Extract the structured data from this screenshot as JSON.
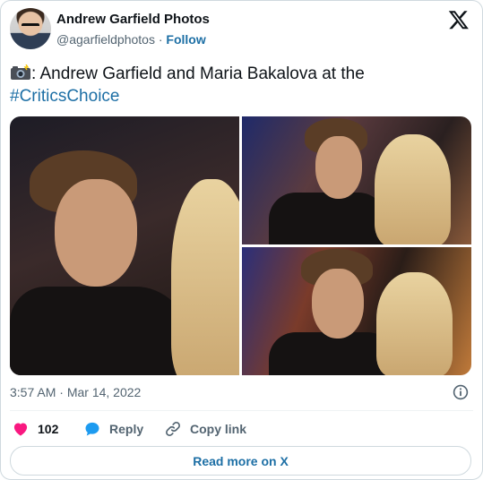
{
  "author": {
    "display_name": "Andrew Garfield Photos",
    "handle": "@agarfieldphotos",
    "separator": "·",
    "follow_label": "Follow"
  },
  "tweet": {
    "text_after_emoji": ": Andrew Garfield and Maria Bakalova at the",
    "hashtag": "#CriticsChoice",
    "emoji_icon": "camera-flash-icon"
  },
  "media": {
    "photo_count": 3
  },
  "meta": {
    "time": "3:57 AM",
    "separator": "·",
    "date": "Mar 14, 2022"
  },
  "actions": {
    "like_count": "102",
    "reply_label": "Reply",
    "copy_link_label": "Copy link"
  },
  "footer": {
    "read_more_label": "Read more on X"
  },
  "colors": {
    "link": "#1d6fa5",
    "like": "#f91880",
    "reply": "#1d9bf0",
    "muted_text": "#536471"
  }
}
